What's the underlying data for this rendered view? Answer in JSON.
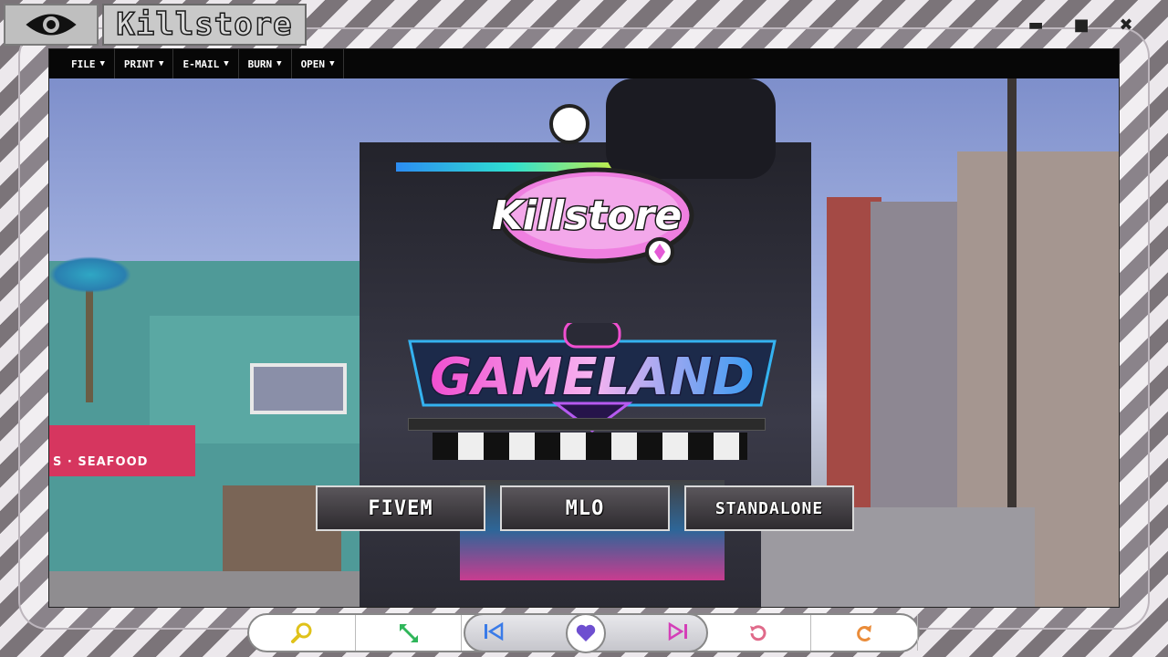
{
  "window": {
    "title": "Killstore",
    "controls": {
      "minimize": "▬",
      "maximize": "■",
      "close": "✖"
    }
  },
  "menu": {
    "items": [
      {
        "label": "File"
      },
      {
        "label": "Print"
      },
      {
        "label": "E-mail"
      },
      {
        "label": "Burn"
      },
      {
        "label": "Open"
      }
    ]
  },
  "hero": {
    "brand_logo": "Killstore",
    "store_sign": "GAMELAND",
    "awning_sign": "S · SEAFOOD"
  },
  "categories": [
    {
      "label": "FiveM"
    },
    {
      "label": "MLO"
    },
    {
      "label": "Standalone"
    }
  ],
  "toolbar": {
    "buttons": [
      {
        "icon": "search-icon"
      },
      {
        "icon": "expand-icon"
      },
      {
        "icon": "skip-previous-icon"
      },
      {
        "icon": "heart-icon"
      },
      {
        "icon": "skip-next-icon"
      },
      {
        "icon": "rotate-left-icon"
      },
      {
        "icon": "rotate-right-icon"
      }
    ]
  },
  "colors": {
    "accent_pink": "#e45ad6",
    "accent_blue": "#3a9bf2",
    "heart_purple": "#6e4fd0",
    "search_yellow": "#e0c21a",
    "expand_green": "#2fb65a",
    "rotate_pink": "#e06a8a",
    "rotate_orange": "#ea8c3a"
  }
}
